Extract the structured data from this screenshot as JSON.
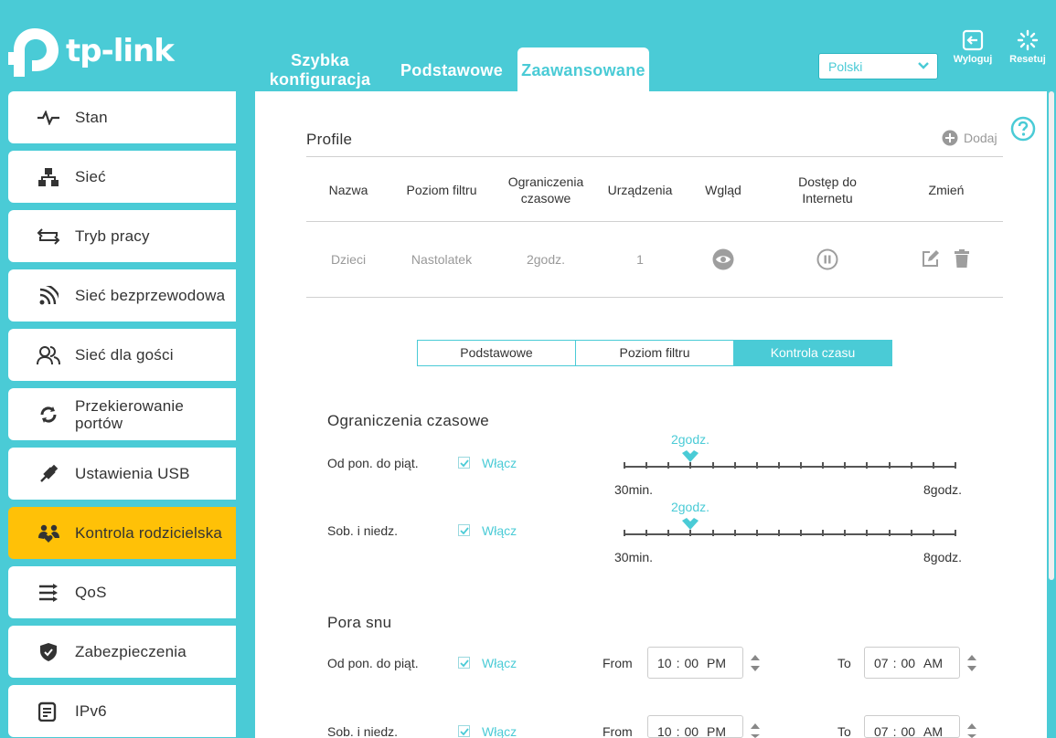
{
  "brand": {
    "logo_text": "tp-link"
  },
  "nav": {
    "tabs": [
      {
        "line1": "Szybka",
        "line2": "konfiguracja"
      },
      {
        "label": "Podstawowe"
      },
      {
        "label": "Zaawansowane"
      }
    ]
  },
  "header": {
    "language": "Polski",
    "logout_label": "Wyloguj",
    "reset_label": "Resetuj"
  },
  "sidebar": {
    "items": [
      {
        "label": "Stan",
        "icon": "pulse-icon"
      },
      {
        "label": "Sieć",
        "icon": "network-icon"
      },
      {
        "label": "Tryb pracy",
        "icon": "mode-switch-icon"
      },
      {
        "label": "Sieć bezprzewodowa",
        "icon": "wireless-icon"
      },
      {
        "label": "Sieć dla gości",
        "icon": "guests-icon"
      },
      {
        "label": "Przekierowanie portów",
        "icon": "port-forward-icon"
      },
      {
        "label": "Ustawienia USB",
        "icon": "usb-icon"
      },
      {
        "label": "Kontrola rodzicielska",
        "icon": "parental-icon"
      },
      {
        "label": "QoS",
        "icon": "qos-icon"
      },
      {
        "label": "Zabezpieczenia",
        "icon": "shield-icon"
      },
      {
        "label": "IPv6",
        "icon": "ipv6-icon"
      }
    ]
  },
  "profiles": {
    "title": "Profile",
    "add_label": "Dodaj",
    "columns": {
      "name": "Nazwa",
      "filter": "Poziom filtru",
      "time_limit_l1": "Ograniczenia",
      "time_limit_l2": "czasowe",
      "devices": "Urządzenia",
      "insight": "Wgląd",
      "access_l1": "Dostęp do",
      "access_l2": "Internetu",
      "modify": "Zmień"
    },
    "rows": [
      {
        "name": "Dzieci",
        "filter": "Nastolatek",
        "time_limit": "2godz.",
        "devices": "1"
      }
    ]
  },
  "subtabs": [
    "Podstawowe",
    "Poziom filtru",
    "Kontrola czasu"
  ],
  "time_limits": {
    "title": "Ograniczenia czasowe",
    "slider_min": "30min.",
    "slider_max": "8godz.",
    "rows": [
      {
        "label": "Od pon. do piąt.",
        "enable_label": "Włącz",
        "checked": true,
        "value_label": "2godz.",
        "value_hours": 2
      },
      {
        "label": "Sob. i niedz.",
        "enable_label": "Włącz",
        "checked": true,
        "value_label": "2godz.",
        "value_hours": 2
      }
    ]
  },
  "bedtime": {
    "title": "Pora snu",
    "from_label": "From",
    "to_label": "To",
    "rows": [
      {
        "label": "Od pon. do piąt.",
        "enable_label": "Włącz",
        "checked": true,
        "from": {
          "h": "10",
          "m": "00",
          "ampm": "PM"
        },
        "to": {
          "h": "07",
          "m": "00",
          "ampm": "AM"
        }
      },
      {
        "label": "Sob. i niedz.",
        "enable_label": "Włącz",
        "checked": true,
        "from": {
          "h": "10",
          "m": "00",
          "ampm": "PM"
        },
        "to": {
          "h": "07",
          "m": "00",
          "ampm": "AM"
        }
      }
    ]
  },
  "colors": {
    "accent": "#4acbd6",
    "active_sidebar": "#ffc107"
  }
}
